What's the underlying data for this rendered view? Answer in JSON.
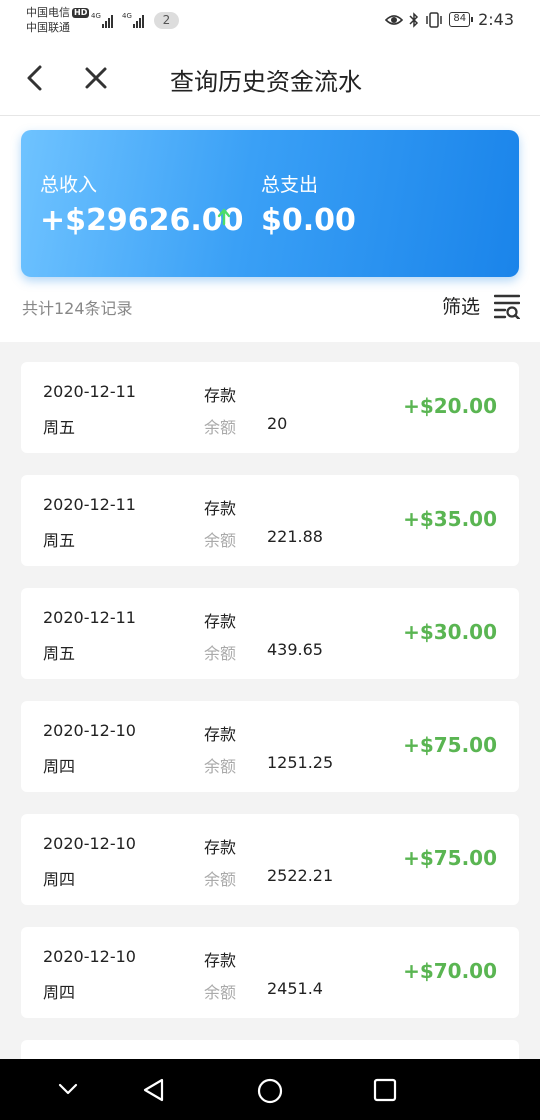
{
  "status_bar": {
    "carrier1": "中国电信",
    "hd": "HD",
    "carrier2": "中国联通",
    "net1": "4G",
    "net2": "4G",
    "sim_count": "2",
    "battery": "84",
    "time": "2:43",
    "icons": [
      "eye-icon",
      "bluetooth-icon",
      "vibrate-icon",
      "battery-icon"
    ]
  },
  "nav": {
    "title": "查询历史资金流水",
    "icons": [
      "back-arrow-icon",
      "close-icon"
    ]
  },
  "summary": {
    "income_label": "总收入",
    "income_value": "+$29626.00",
    "expense_label": "总支出",
    "expense_value": "$0.00",
    "trend_icon": "up-arrow-icon",
    "trend_color": "#4ddc6a"
  },
  "list_header": {
    "record_count": "共计124条记录",
    "filter_label": "筛选",
    "filter_icon": "filter-list-icon"
  },
  "balance_label": "余额",
  "transactions": [
    {
      "date": "2020-12-11",
      "weekday": "周五",
      "type": "存款",
      "balance": "20",
      "amount": "+$20.00"
    },
    {
      "date": "2020-12-11",
      "weekday": "周五",
      "type": "存款",
      "balance": "221.88",
      "amount": "+$35.00"
    },
    {
      "date": "2020-12-11",
      "weekday": "周五",
      "type": "存款",
      "balance": "439.65",
      "amount": "+$30.00"
    },
    {
      "date": "2020-12-10",
      "weekday": "周四",
      "type": "存款",
      "balance": "1251.25",
      "amount": "+$75.00"
    },
    {
      "date": "2020-12-10",
      "weekday": "周四",
      "type": "存款",
      "balance": "2522.21",
      "amount": "+$75.00"
    },
    {
      "date": "2020-12-10",
      "weekday": "周四",
      "type": "存款",
      "balance": "2451.4",
      "amount": "+$70.00"
    },
    {
      "date": "",
      "weekday": "",
      "type": "",
      "balance": "",
      "amount": ""
    }
  ],
  "colors": {
    "accent_blue": "#1a84ea",
    "amount_green": "#5ab552"
  },
  "system_nav": [
    "collapse-icon",
    "back-triangle-icon",
    "home-circle-icon",
    "recents-square-icon"
  ]
}
